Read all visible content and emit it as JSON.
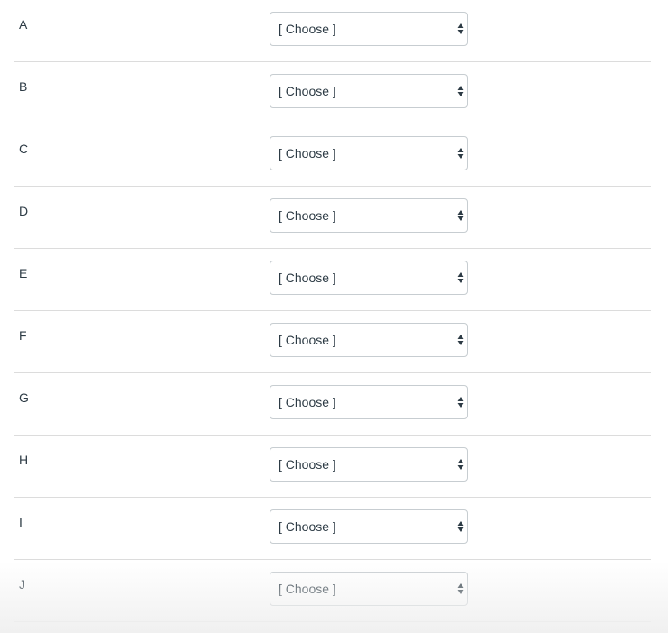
{
  "rows": [
    {
      "label": "A",
      "selected": "[ Choose ]"
    },
    {
      "label": "B",
      "selected": "[ Choose ]"
    },
    {
      "label": "C",
      "selected": "[ Choose ]"
    },
    {
      "label": "D",
      "selected": "[ Choose ]"
    },
    {
      "label": "E",
      "selected": "[ Choose ]"
    },
    {
      "label": "F",
      "selected": "[ Choose ]"
    },
    {
      "label": "G",
      "selected": "[ Choose ]"
    },
    {
      "label": "H",
      "selected": "[ Choose ]"
    },
    {
      "label": "I",
      "selected": "[ Choose ]"
    },
    {
      "label": "J",
      "selected": "[ Choose ]"
    }
  ],
  "icons": {
    "select_arrows": "up-down-arrows-icon"
  }
}
